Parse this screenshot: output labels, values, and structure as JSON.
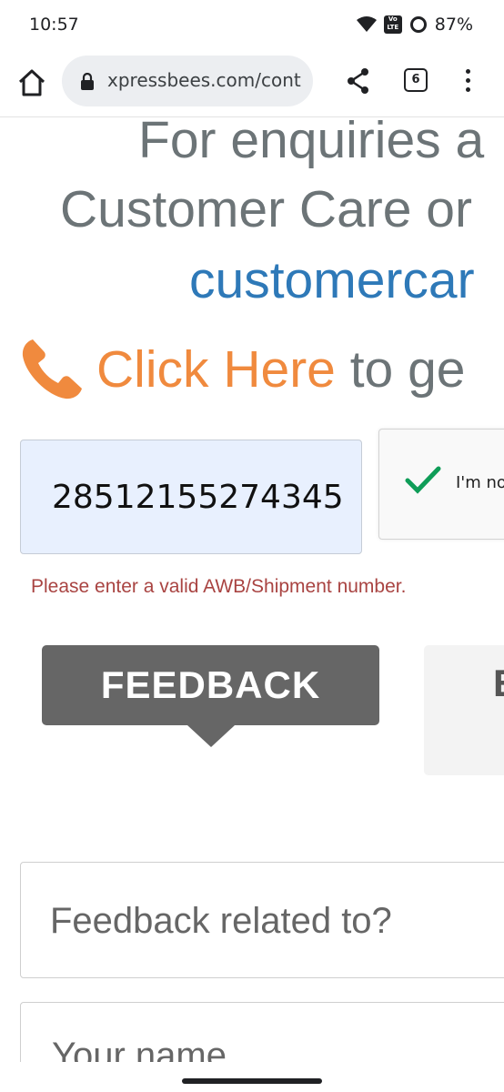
{
  "status_bar": {
    "time": "10:57",
    "volte": "Vo LTE",
    "battery": "87%"
  },
  "browser": {
    "url": "xpressbees.com/cont",
    "tab_count": "6"
  },
  "hero": {
    "line1": "For enquiries a",
    "line2": "Customer Care or",
    "line3": "customercar",
    "line4_link": "Click Here",
    "line4_rest": " to ge"
  },
  "form": {
    "awb_value": "28512155274345",
    "captcha_label": "I'm no",
    "error": "Please enter a valid AWB/Shipment number.",
    "feedback_tab": "FEEDBACK",
    "second_tab": "E",
    "feedback_select": "Feedback related to?",
    "name_placeholder": "Your name"
  },
  "colors": {
    "gray_text": "#6c7477",
    "link_blue": "#2e79b8",
    "accent_orange": "#f08a3e",
    "error_red": "#a94442",
    "input_bg": "#e8f0fe",
    "tab_bg": "#666666",
    "check_green": "#0f9d58"
  }
}
